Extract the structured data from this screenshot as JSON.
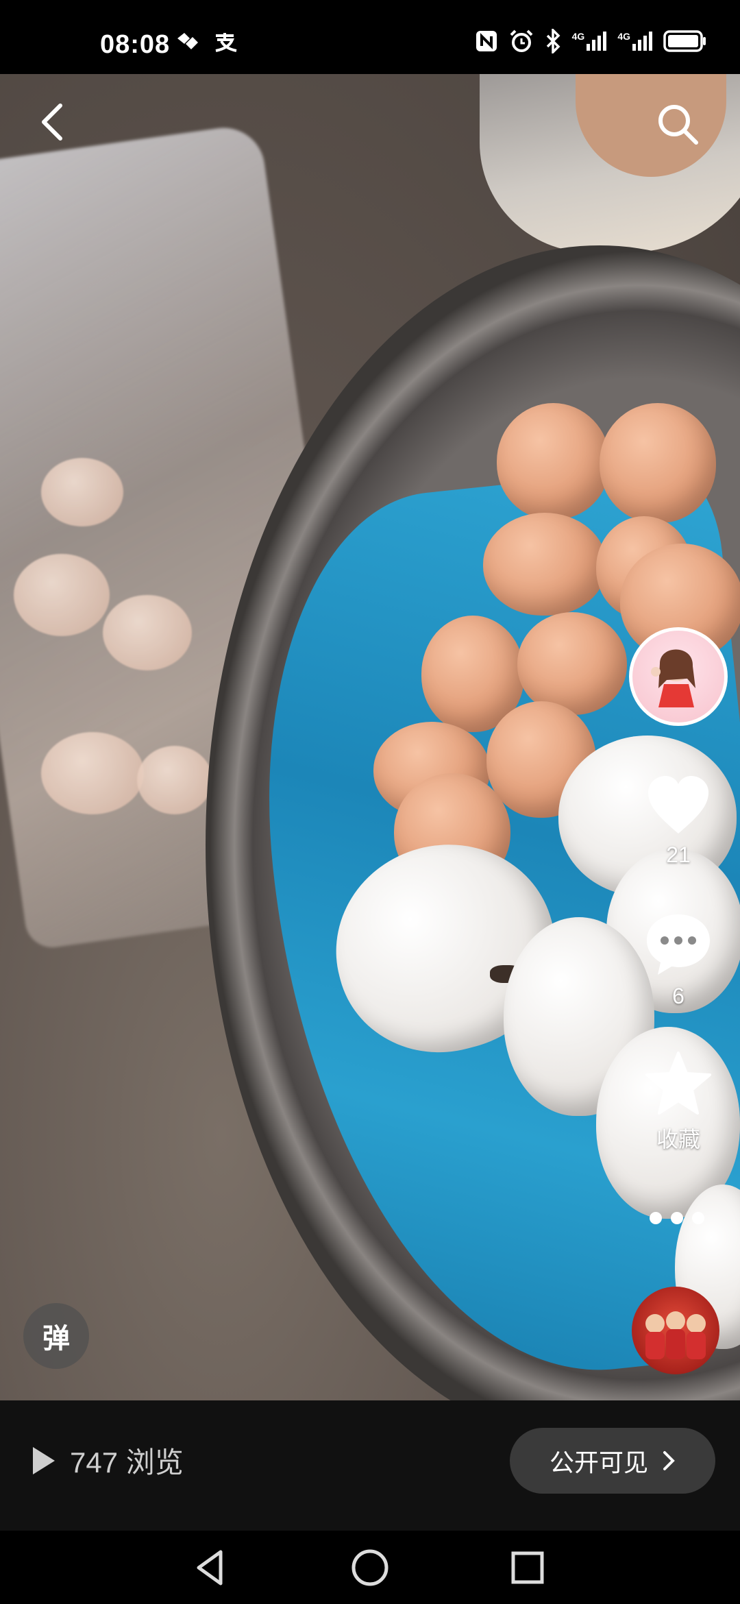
{
  "status_bar": {
    "time": "08:08",
    "left_icons": [
      "heartbeat-icon",
      "alipay-icon"
    ],
    "right_icons": [
      "nfc-icon",
      "alarm-icon",
      "bluetooth-icon",
      "signal-4g-icon",
      "signal-4g-icon",
      "battery-icon"
    ],
    "network_label": "4G"
  },
  "top_bar": {
    "back_icon": "back-arrow-icon",
    "search_icon": "search-icon"
  },
  "side_actions": {
    "like_count": "21",
    "comment_count": "6",
    "favorite_label": "收藏"
  },
  "danmu": {
    "label": "弹"
  },
  "info_bar": {
    "views_text": "747 浏览",
    "visibility_label": "公开可见"
  },
  "nav_bar": {
    "icons": [
      "nav-back-icon",
      "nav-home-icon",
      "nav-recents-icon"
    ]
  }
}
